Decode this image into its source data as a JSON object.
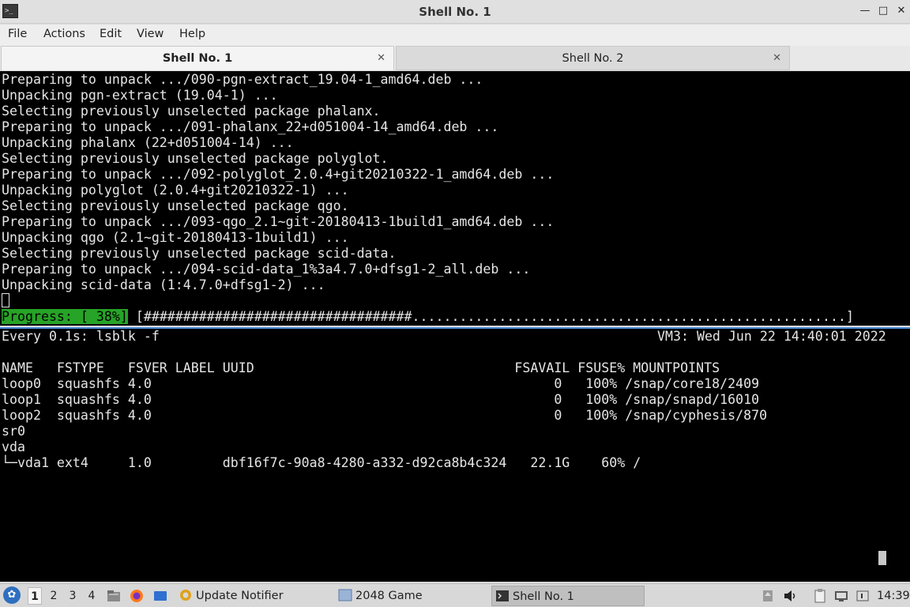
{
  "window": {
    "title": "Shell No. 1",
    "app_icon": "terminal-icon",
    "controls": [
      "minimize",
      "maximize",
      "close"
    ]
  },
  "menu": [
    "File",
    "Actions",
    "Edit",
    "View",
    "Help"
  ],
  "tabs": [
    {
      "label": "Shell No. 1",
      "active": true
    },
    {
      "label": "Shell No. 2",
      "active": false
    }
  ],
  "terminal_top": {
    "lines": [
      "Preparing to unpack .../090-pgn-extract_19.04-1_amd64.deb ...",
      "Unpacking pgn-extract (19.04-1) ...",
      "Selecting previously unselected package phalanx.",
      "Preparing to unpack .../091-phalanx_22+d051004-14_amd64.deb ...",
      "Unpacking phalanx (22+d051004-14) ...",
      "Selecting previously unselected package polyglot.",
      "Preparing to unpack .../092-polyglot_2.0.4+git20210322-1_amd64.deb ...",
      "Unpacking polyglot (2.0.4+git20210322-1) ...",
      "Selecting previously unselected package qgo.",
      "Preparing to unpack .../093-qgo_2.1~git-20180413-1build1_amd64.deb ...",
      "Unpacking qgo (2.1~git-20180413-1build1) ...",
      "Selecting previously unselected package scid-data.",
      "Preparing to unpack .../094-scid-data_1%3a4.7.0+dfsg1-2_all.deb ...",
      "Unpacking scid-data (1:4.7.0+dfsg1-2) ..."
    ],
    "progress_label": "Progress: [ 38%]",
    "progress_percent": 38,
    "progress_bar": " [##################################.......................................................]"
  },
  "terminal_bottom": {
    "header_left": "Every 0.1s: lsblk -f",
    "header_right": "VM3: Wed Jun 22 14:40:01 2022",
    "lines": [
      "NAME   FSTYPE   FSVER LABEL UUID                                 FSAVAIL FSUSE% MOUNTPOINTS",
      "loop0  squashfs 4.0                                                   0   100% /snap/core18/2409",
      "loop1  squashfs 4.0                                                   0   100% /snap/snapd/16010",
      "loop2  squashfs 4.0                                                   0   100% /snap/cyphesis/870",
      "sr0",
      "vda",
      "└─vda1 ext4     1.0         dbf16f7c-90a8-4280-a332-d92ca8b4c324   22.1G    60% /"
    ]
  },
  "taskbar": {
    "workspaces": [
      "1",
      "2",
      "3",
      "4"
    ],
    "active_workspace": "1",
    "tasks": [
      {
        "label": "Update Notifier",
        "icon": "update-notifier-icon",
        "active": false
      },
      {
        "label": "2048 Game",
        "icon": "game-window-icon",
        "active": false
      },
      {
        "label": "Shell No. 1",
        "icon": "terminal-icon",
        "active": true
      }
    ],
    "clock": "14:39"
  },
  "colors": {
    "progress_green": "#27a327",
    "focus_border": "#4a8ad8"
  }
}
